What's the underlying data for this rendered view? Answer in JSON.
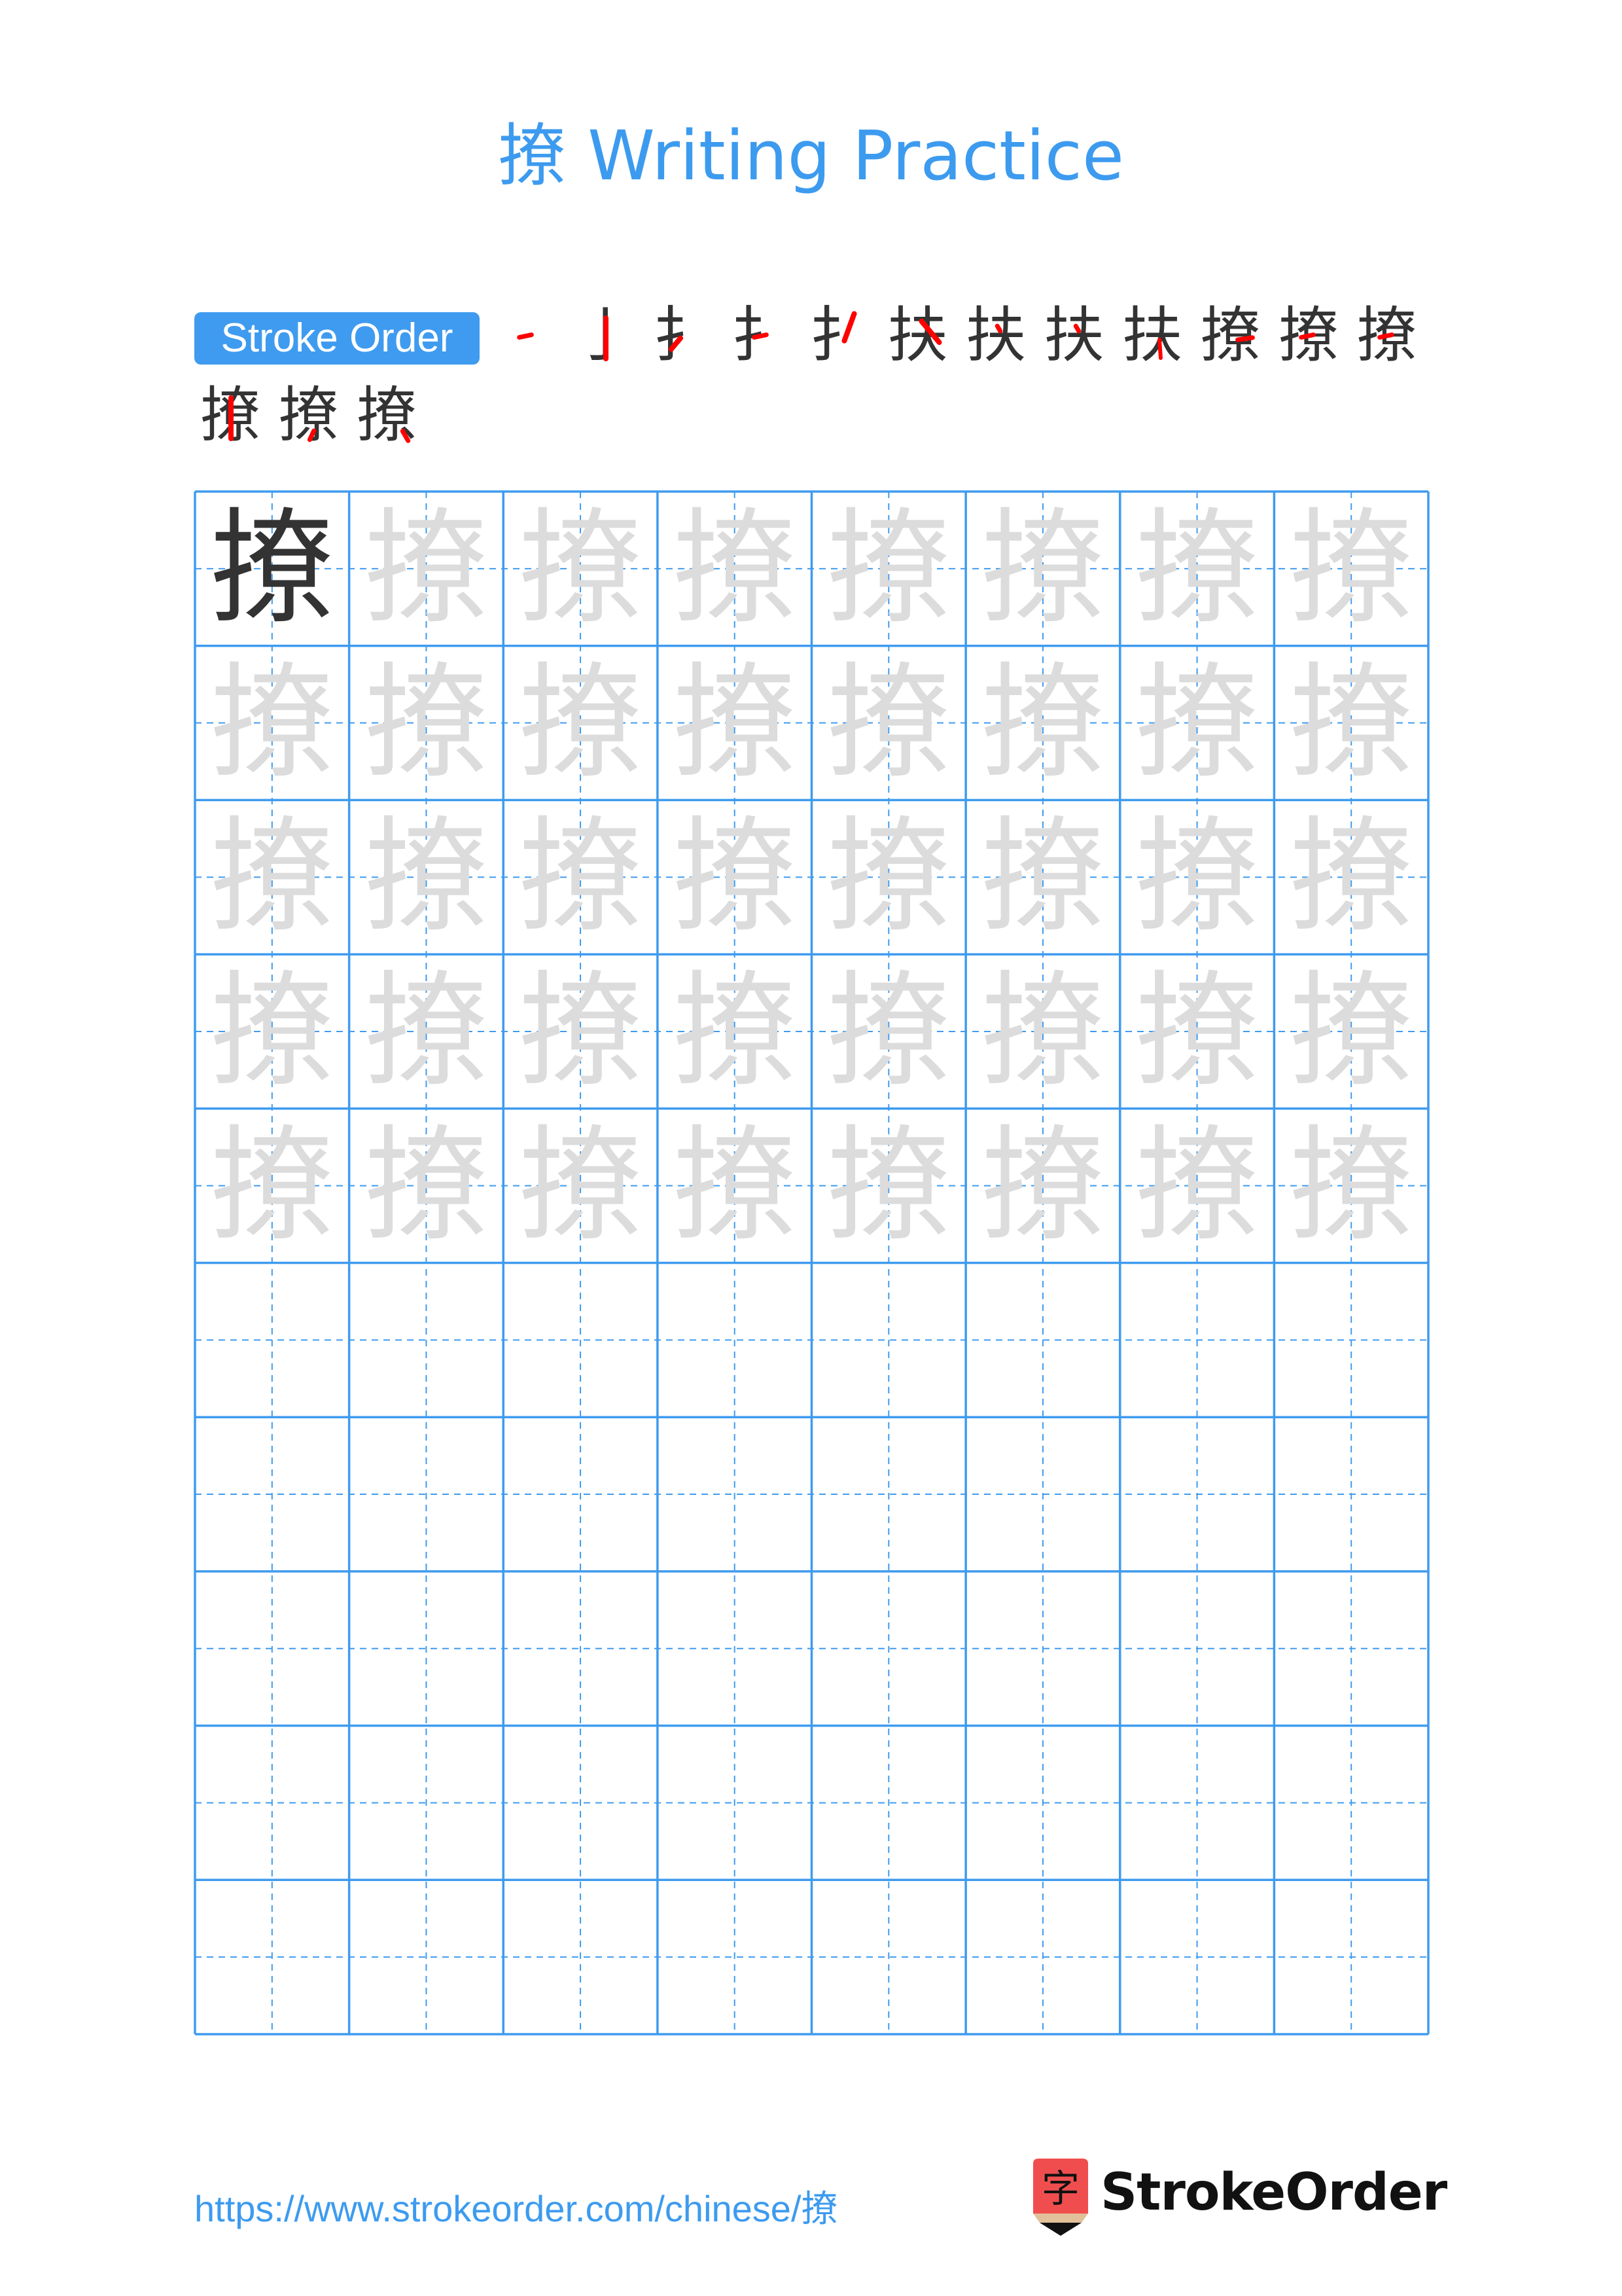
{
  "page": {
    "title": "撩 Writing Practice",
    "character": "撩",
    "colors": {
      "accent": "#3d9bef",
      "grid_line": "#3f9bef",
      "model_char": "#333333",
      "trace_char": "#dcdcdc",
      "stroke_highlight": "#ff0000",
      "logo_red": "#f04e4e",
      "logo_tan": "#e2c09a"
    }
  },
  "stroke_order": {
    "label": "Stroke Order",
    "stroke_count": 15,
    "steps": [
      {
        "step": 1,
        "glyph": "",
        "highlight": "horizontal"
      },
      {
        "step": 2,
        "glyph": "亅",
        "highlight": "vertical-hook"
      },
      {
        "step": 3,
        "glyph": "扌",
        "highlight": "rising"
      },
      {
        "step": 4,
        "glyph": "扌",
        "highlight": "horizontal"
      },
      {
        "step": 5,
        "glyph": "扌",
        "highlight": "left-falling"
      },
      {
        "step": 6,
        "glyph": "扶",
        "highlight": "right-falling"
      },
      {
        "step": 7,
        "glyph": "扶",
        "highlight": "dot"
      },
      {
        "step": 8,
        "glyph": "扶",
        "highlight": "dot"
      },
      {
        "step": 9,
        "glyph": "扶",
        "highlight": "vertical"
      },
      {
        "step": 10,
        "glyph": "撩",
        "highlight": "horizontal-turn"
      },
      {
        "step": 11,
        "glyph": "撩",
        "highlight": "horizontal"
      },
      {
        "step": 12,
        "glyph": "撩",
        "highlight": "horizontal"
      },
      {
        "step": 13,
        "glyph": "撩",
        "highlight": "vertical-hook"
      },
      {
        "step": 14,
        "glyph": "撩",
        "highlight": "left-dot"
      },
      {
        "step": 15,
        "glyph": "撩",
        "highlight": "right-dot"
      }
    ]
  },
  "practice_grid": {
    "columns": 8,
    "rows": 10,
    "model_cells": 1,
    "trace_rows": 5,
    "empty_rows": 5
  },
  "footer": {
    "url": "https://www.strokeorder.com/chinese/撩",
    "logo_glyph": "字",
    "brand": "StrokeOrder"
  }
}
